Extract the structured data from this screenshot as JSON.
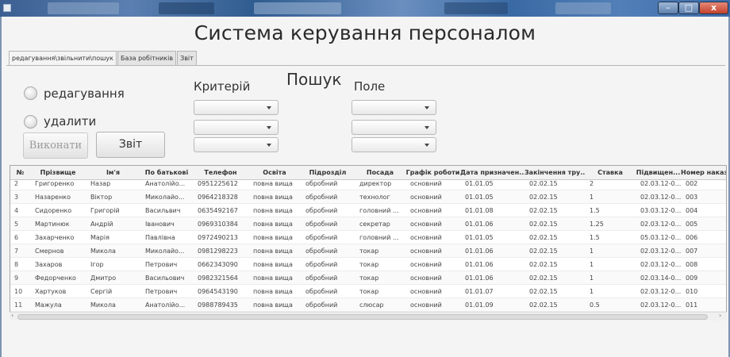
{
  "window": {
    "title_controls": {
      "minimize": "–",
      "maximize": "□",
      "close": "x"
    }
  },
  "app": {
    "title": "Система керування персоналом"
  },
  "tabs": [
    {
      "label": "редагування\\звільнити\\пошук",
      "active": true
    },
    {
      "label": "База робітників",
      "active": false
    },
    {
      "label": "Звіт",
      "active": false
    }
  ],
  "form": {
    "radio_edit": "редагування",
    "radio_delete": "удалити",
    "criteria_label": "Критерій",
    "search_label": "Пошук",
    "field_label": "Поле",
    "execute_button": "Виконати",
    "report_button": "Звіт"
  },
  "table": {
    "columns": [
      "№",
      "Прізвище",
      "Ім'я",
      "По батькові",
      "Телефон",
      "Освіта",
      "Підрозділ",
      "Посада",
      "Графік роботи",
      "Дата призначен...",
      "Закінчення тру...",
      "Ставка",
      "Підвищен...",
      "Номер наказу"
    ],
    "rows": [
      [
        "2",
        "Григоренко",
        "Назар",
        "Анатолійо...",
        "0951225612",
        "повна вища",
        "обробний",
        "директор",
        "основний",
        "01.01.05",
        "02.02.15",
        "2",
        "02.03.12-0...",
        "002"
      ],
      [
        "3",
        "Назаренко",
        "Віктор",
        "Миколайо...",
        "0964218328",
        "повна вища",
        "обробний",
        "технолог",
        "основний",
        "01.01.05",
        "02.02.15",
        "1",
        "02.03.12-0...",
        "003"
      ],
      [
        "4",
        "Сидоренко",
        "Григорій",
        "Васильвич",
        "0635492167",
        "повна вища",
        "обробний",
        "головний ...",
        "основний",
        "01.01.08",
        "02.02.15",
        "1.5",
        "03.03.12-0...",
        "004"
      ],
      [
        "5",
        "Мартинюк",
        "Андрій",
        "Іванович",
        "0969310384",
        "повна вища",
        "обробний",
        "секретар",
        "основний",
        "01.01.06",
        "02.02.15",
        "1.25",
        "02.03.12-0...",
        "005"
      ],
      [
        "6",
        "Захарченко",
        "Марія",
        "Павлівна",
        "0972490213",
        "повна вища",
        "обробний",
        "головний ...",
        "основний",
        "01.01.05",
        "02.02.15",
        "1.5",
        "05.03.12-0...",
        "006"
      ],
      [
        "7",
        "Смернов",
        "Микола",
        "Миколайо...",
        "0981298223",
        "повна вища",
        "обробний",
        "токар",
        "основний",
        "01.01.06",
        "02.02.15",
        "1",
        "02.03.12-0...",
        "007"
      ],
      [
        "8",
        "Захаров",
        "Ігор",
        "Петрович",
        "0662343090",
        "повна вища",
        "обробний",
        "токар",
        "основний",
        "01.01.06",
        "02.02.15",
        "1",
        "02.03.12-0...",
        "008"
      ],
      [
        "9",
        "Федорченко",
        "Дмитро",
        "Васильович",
        "0982321564",
        "повна вища",
        "обробний",
        "токар",
        "основний",
        "01.01.06",
        "02.02.15",
        "1",
        "02.03.14-0...",
        "009"
      ],
      [
        "10",
        "Хартуков",
        "Сергій",
        "Петрович",
        "0964543190",
        "повна вища",
        "обробний",
        "токар",
        "основний",
        "01.01.07",
        "02.02.15",
        "1",
        "02.03.12-0...",
        "010"
      ],
      [
        "11",
        "Мажула",
        "Микола",
        "Анатолійо...",
        "0988789435",
        "повна вища",
        "обробний",
        "слюсар",
        "основний",
        "01.01.09",
        "02.02.15",
        "0.5",
        "02.03.12-0...",
        "011"
      ]
    ]
  },
  "scroll": {
    "left_arrow": "‹",
    "right_arrow": "›",
    "up_arrow": "^",
    "down_arrow": "v"
  }
}
